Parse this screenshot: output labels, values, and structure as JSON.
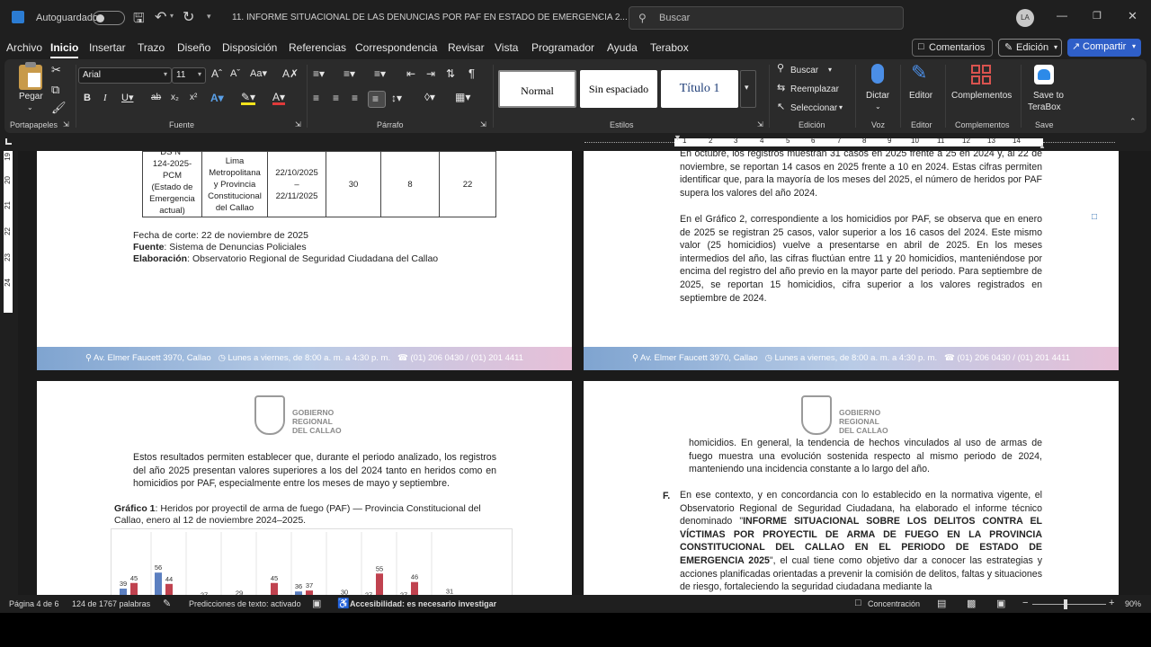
{
  "titlebar": {
    "autosave_label": "Autoguardado",
    "doc_title": "11. INFORME SITUACIONAL DE LAS DENUNCIAS POR PAF EN ESTADO DE EMERGENCIA 2...",
    "search_placeholder": "Buscar",
    "avatar_initials": "LA"
  },
  "menu": [
    "Archivo",
    "Inicio",
    "Insertar",
    "Trazo",
    "Diseño",
    "Disposición",
    "Referencias",
    "Correspondencia",
    "Revisar",
    "Vista",
    "Programador",
    "Ayuda",
    "Terabox"
  ],
  "menu_right": {
    "comments": "Comentarios",
    "edit": "Edición",
    "share": "Compartir"
  },
  "ribbon": {
    "clipboard": {
      "paste": "Pegar",
      "label": "Portapapeles"
    },
    "font": {
      "name": "Arial",
      "size": "11",
      "label": "Fuente"
    },
    "paragraph": {
      "label": "Párrafo"
    },
    "styles": {
      "items": [
        "Normal",
        "Sin espaciado",
        "Título 1"
      ],
      "label": "Estilos"
    },
    "editing": {
      "find": "Buscar",
      "replace": "Reemplazar",
      "select": "Seleccionar",
      "label": "Edición"
    },
    "voice": {
      "dictate": "Dictar",
      "label": "Voz"
    },
    "editor": {
      "editor": "Editor",
      "label": "Editor"
    },
    "addins": {
      "complements": "Complementos",
      "label": "Complementos"
    },
    "save": {
      "line1": "Save to",
      "line2": "TeraBox",
      "label": "Save"
    }
  },
  "ruler_numbers": [
    "1",
    "2",
    "3",
    "4",
    "5",
    "6",
    "7",
    "8",
    "9",
    "10",
    "11",
    "12",
    "13",
    "14"
  ],
  "vruler_numbers": [
    "19",
    "20",
    "21",
    "22",
    "23",
    "24"
  ],
  "page1": {
    "table_row": {
      "c1": "DS N° 124-2025-PCM (Estado de Emergencia actual)",
      "c1_lines": [
        "DS N°",
        "124-2025-",
        "PCM",
        "(Estado de",
        "Emergencia",
        "actual)"
      ],
      "c2_lines": [
        "Lima",
        "Metropolitana",
        "y Provincia",
        "Constitucional",
        "del Callao"
      ],
      "c3_lines": [
        "22/10/2025",
        "–",
        "22/11/2025"
      ],
      "c4": "30",
      "c5": "8",
      "c6": "22"
    },
    "cut_date": "Fecha de corte: 22 de noviembre de 2025",
    "source_label": "Fuente",
    "source_text": ": Sistema de Denuncias Policiales",
    "elab_label": "Elaboración",
    "elab_text": ": Observatorio Regional de Seguridad Ciudadana del Callao"
  },
  "footer": {
    "address": "Av. Elmer Faucett 3970, Callao",
    "hours": "Lunes a viernes, de 8:00 a. m. a 4:30 p. m.",
    "phone": "(01) 206 0430 / (01)  201 4411"
  },
  "page2": {
    "p1": "En octubre, los registros muestran 31 casos en 2025 frente a 25 en 2024 y, al 22 de noviembre, se reportan 14 casos en 2025 frente a 10 en 2024. Estas cifras permiten identificar que, para la mayoría de los meses del 2025, el número de heridos por PAF supera los valores del año 2024.",
    "p2": "En el Gráfico 2, correspondiente a los homicidios por PAF, se observa que en enero de 2025 se registran 25 casos, valor superior a los 16 casos del 2024. Este mismo valor (25 homicidios) vuelve a presentarse en abril de 2025. En los meses intermedios del año, las cifras fluctúan entre 11 y 20 homicidios, manteniéndose por encima del registro del año previo en la mayor parte del periodo. Para septiembre de 2025, se reportan 15 homicidios, cifra superior a los valores registrados en septiembre de 2024."
  },
  "logo": {
    "line1": "GOBIERNO",
    "line2": "REGIONAL",
    "line3": "DEL CALLAO"
  },
  "page3": {
    "p1": "Estos resultados permiten establecer que, durante el periodo analizado, los registros del año 2025 presentan valores superiores a los del 2024 tanto en heridos como en homicidios por PAF, especialmente entre los meses de mayo y septiembre.",
    "chart_caption_bold": "Gráfico 1",
    "chart_caption": ": Heridos por proyectil de arma de fuego (PAF) — Provincia Constitucional del Callao, enero al 12 de noviembre 2024–2025."
  },
  "page4": {
    "p1": "homicidios. En general, la tendencia de hechos vinculados al uso de armas de fuego muestra una evolución sostenida respecto al mismo periodo de 2024, manteniendo una incidencia constante a lo largo del año.",
    "f_label": "F.",
    "f_text_a": "En ese contexto, y en concordancia con lo establecido en la normativa vigente, el Observatorio Regional de Seguridad Ciudadana, ha elaborado el informe técnico denominado \"",
    "f_bold": "INFORME SITUACIONAL SOBRE LOS DELITOS CONTRA EL VÍCTIMAS POR PROYECTIL DE ARMA DE FUEGO EN LA PROVINCIA CONSTITUCIONAL DEL CALLAO EN EL PERIODO DE ESTADO DE EMERGENCIA 2025",
    "f_text_b": "\", el cual tiene como objetivo dar a conocer las estrategias y acciones planificadas orientadas a prevenir la comisión de delitos, faltas y situaciones de riesgo, fortaleciendo la seguridad ciudadana mediante la"
  },
  "status": {
    "page": "Página 4 de 6",
    "words": "124 de 1767 palabras",
    "predictions": "Predicciones de texto: activado",
    "accessibility": "Accesibilidad: es necesario investigar",
    "focus": "Concentración",
    "zoom": "90%"
  },
  "chart_data": {
    "type": "bar",
    "series": [
      {
        "name": "2024",
        "values": [
          39,
          56,
          null,
          24,
          null,
          36,
          null,
          27,
          27,
          25
        ],
        "color": "#5b7fc0"
      },
      {
        "name": "2025",
        "values": [
          45,
          44,
          27,
          29,
          45,
          37,
          30,
          55,
          46,
          31
        ],
        "color": "#c0424f"
      }
    ]
  }
}
